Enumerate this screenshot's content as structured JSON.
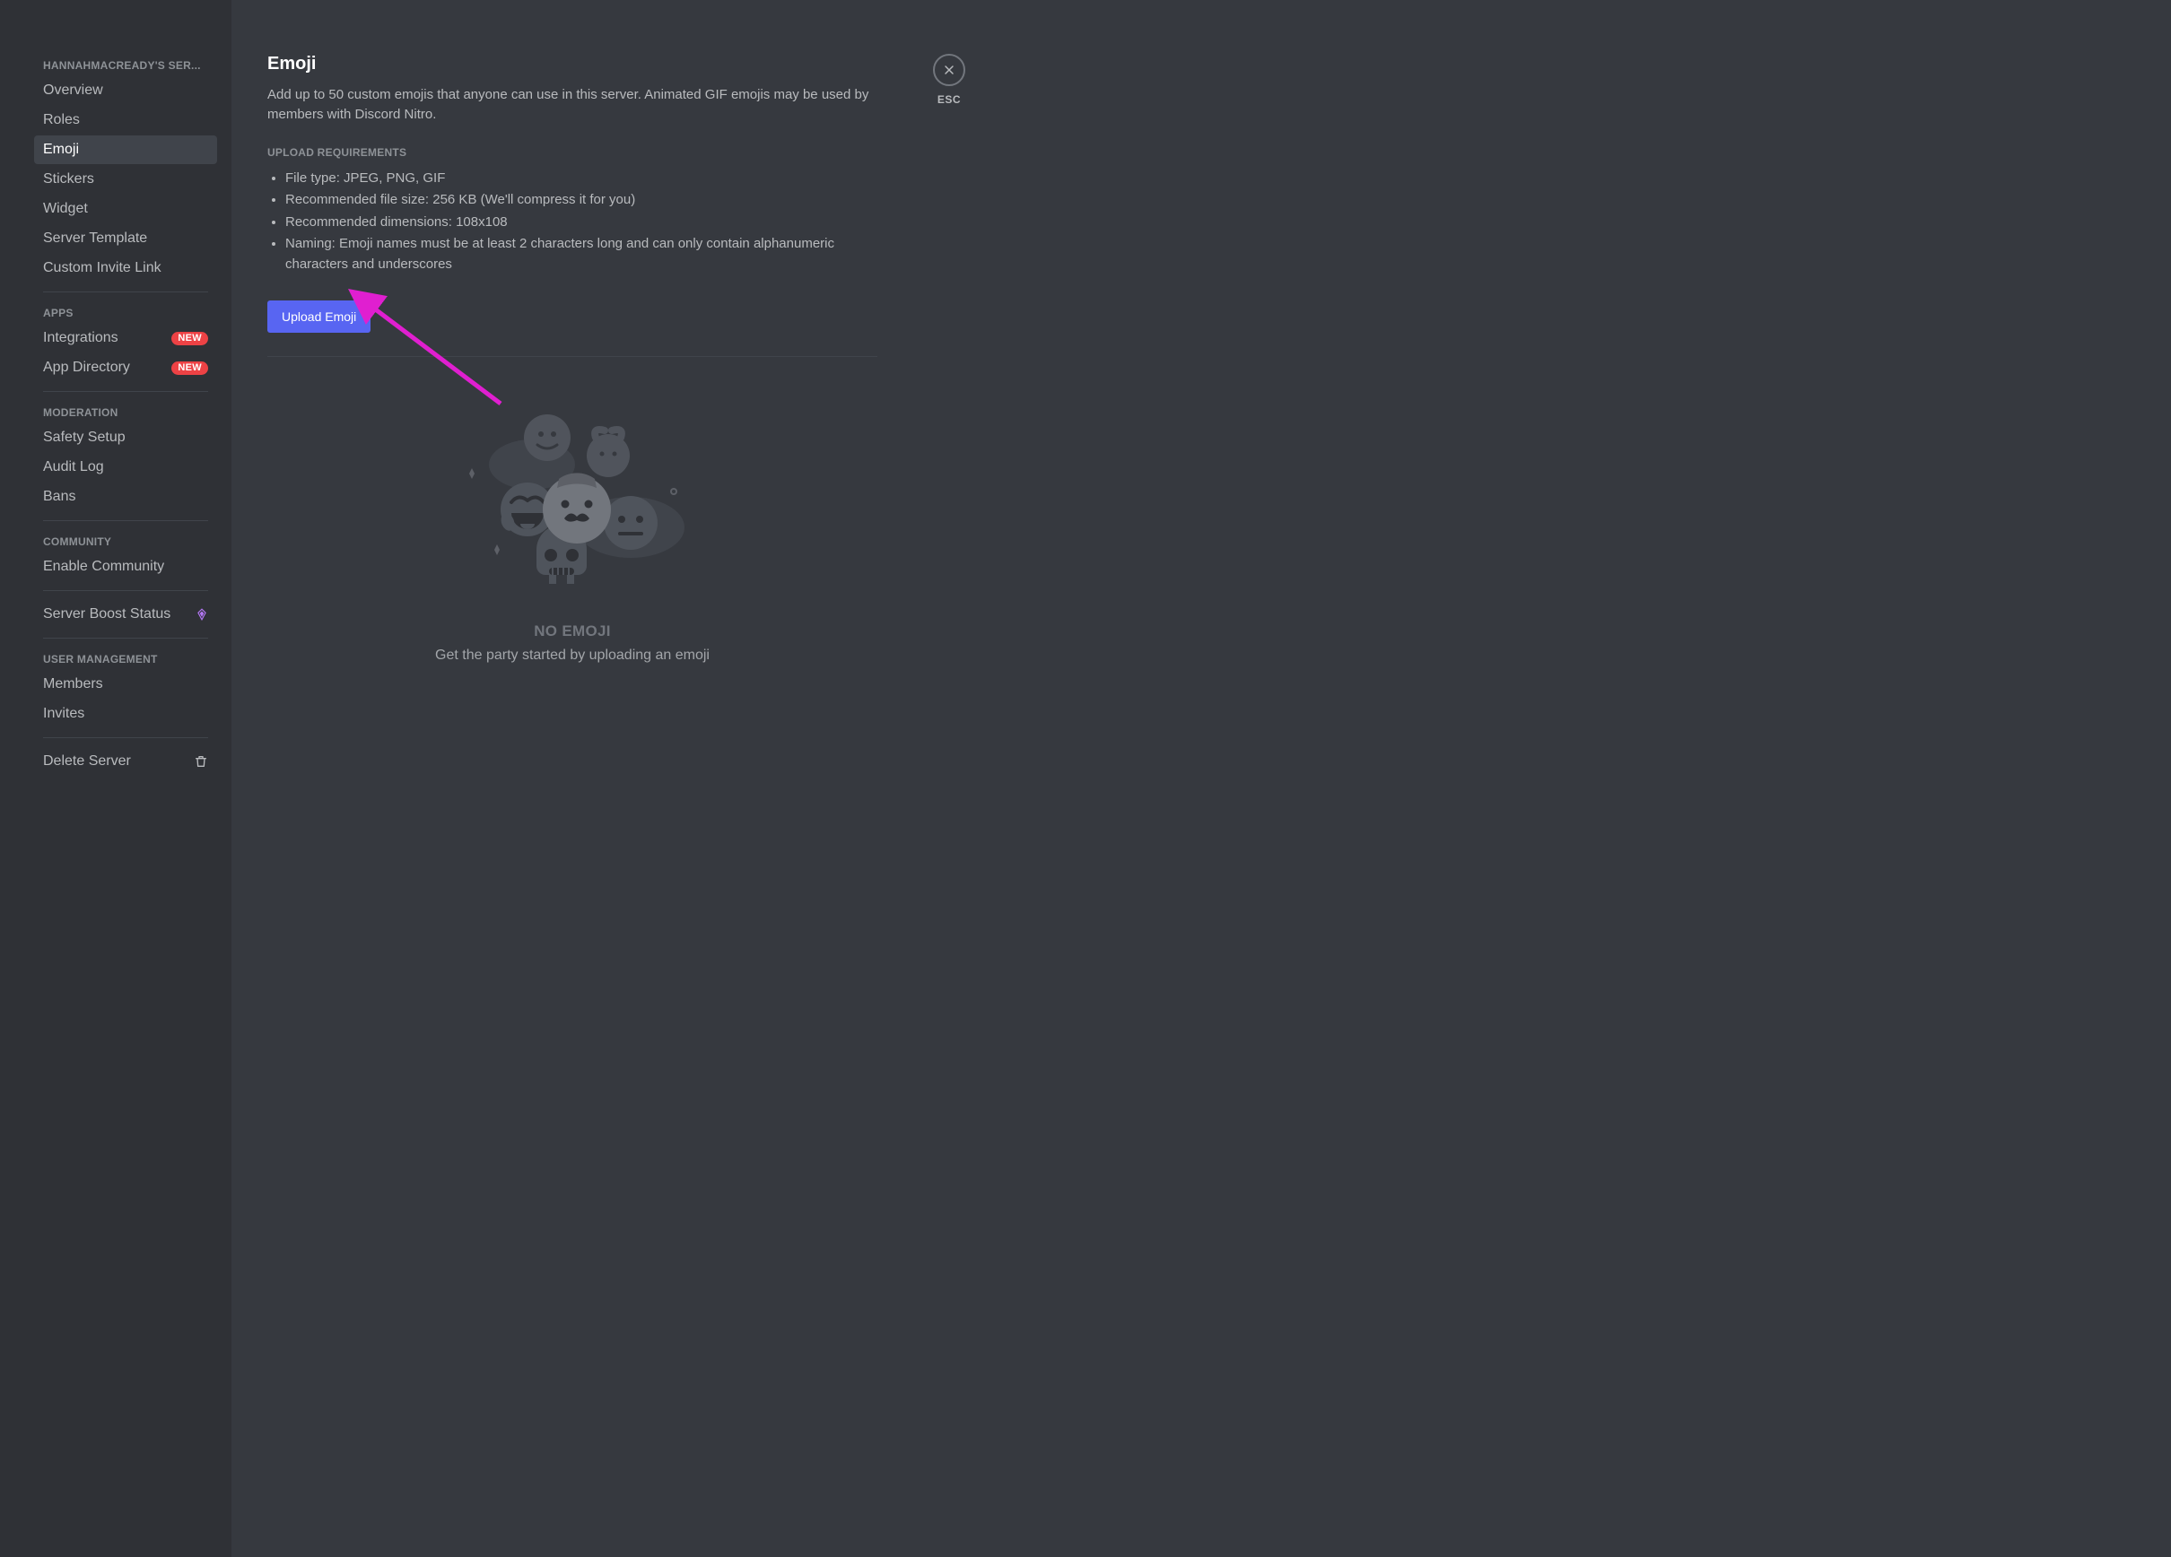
{
  "sidebar": {
    "server_header": "HANNAHMACREADY'S SER...",
    "groups": [
      {
        "header": null,
        "items": [
          {
            "label": "Overview",
            "active": false,
            "badge": null,
            "right_icon": null,
            "slug": "overview"
          },
          {
            "label": "Roles",
            "active": false,
            "badge": null,
            "right_icon": null,
            "slug": "roles"
          },
          {
            "label": "Emoji",
            "active": true,
            "badge": null,
            "right_icon": null,
            "slug": "emoji"
          },
          {
            "label": "Stickers",
            "active": false,
            "badge": null,
            "right_icon": null,
            "slug": "stickers"
          },
          {
            "label": "Widget",
            "active": false,
            "badge": null,
            "right_icon": null,
            "slug": "widget"
          },
          {
            "label": "Server Template",
            "active": false,
            "badge": null,
            "right_icon": null,
            "slug": "server-template"
          },
          {
            "label": "Custom Invite Link",
            "active": false,
            "badge": null,
            "right_icon": null,
            "slug": "custom-invite-link"
          }
        ]
      },
      {
        "header": "APPS",
        "items": [
          {
            "label": "Integrations",
            "active": false,
            "badge": "NEW",
            "right_icon": null,
            "slug": "integrations"
          },
          {
            "label": "App Directory",
            "active": false,
            "badge": "NEW",
            "right_icon": null,
            "slug": "app-directory"
          }
        ]
      },
      {
        "header": "MODERATION",
        "items": [
          {
            "label": "Safety Setup",
            "active": false,
            "badge": null,
            "right_icon": null,
            "slug": "safety-setup"
          },
          {
            "label": "Audit Log",
            "active": false,
            "badge": null,
            "right_icon": null,
            "slug": "audit-log"
          },
          {
            "label": "Bans",
            "active": false,
            "badge": null,
            "right_icon": null,
            "slug": "bans"
          }
        ]
      },
      {
        "header": "COMMUNITY",
        "items": [
          {
            "label": "Enable Community",
            "active": false,
            "badge": null,
            "right_icon": null,
            "slug": "enable-community"
          }
        ]
      },
      {
        "header": null,
        "items": [
          {
            "label": "Server Boost Status",
            "active": false,
            "badge": null,
            "right_icon": "boost",
            "slug": "server-boost-status"
          }
        ]
      },
      {
        "header": "USER MANAGEMENT",
        "items": [
          {
            "label": "Members",
            "active": false,
            "badge": null,
            "right_icon": null,
            "slug": "members"
          },
          {
            "label": "Invites",
            "active": false,
            "badge": null,
            "right_icon": null,
            "slug": "invites"
          }
        ]
      },
      {
        "header": null,
        "items": [
          {
            "label": "Delete Server",
            "active": false,
            "badge": null,
            "right_icon": "trash",
            "slug": "delete-server"
          }
        ]
      }
    ]
  },
  "content": {
    "title": "Emoji",
    "description": "Add up to 50 custom emojis that anyone can use in this server. Animated GIF emojis may be used by members with Discord Nitro.",
    "requirements_header": "UPLOAD REQUIREMENTS",
    "requirements": [
      "File type: JPEG, PNG, GIF",
      "Recommended file size: 256 KB (We'll compress it for you)",
      "Recommended dimensions: 108x108",
      "Naming: Emoji names must be at least 2 characters long and can only contain alphanumeric characters and underscores"
    ],
    "upload_button_label": "Upload Emoji",
    "empty_title": "NO EMOJI",
    "empty_subtitle": "Get the party started by uploading an emoji"
  },
  "close": {
    "label": "ESC"
  },
  "colors": {
    "brand": "#5865f2",
    "badge_red": "#ed4245",
    "boost_purple": "#b377f3",
    "annotation_arrow": "#e01fd0"
  }
}
